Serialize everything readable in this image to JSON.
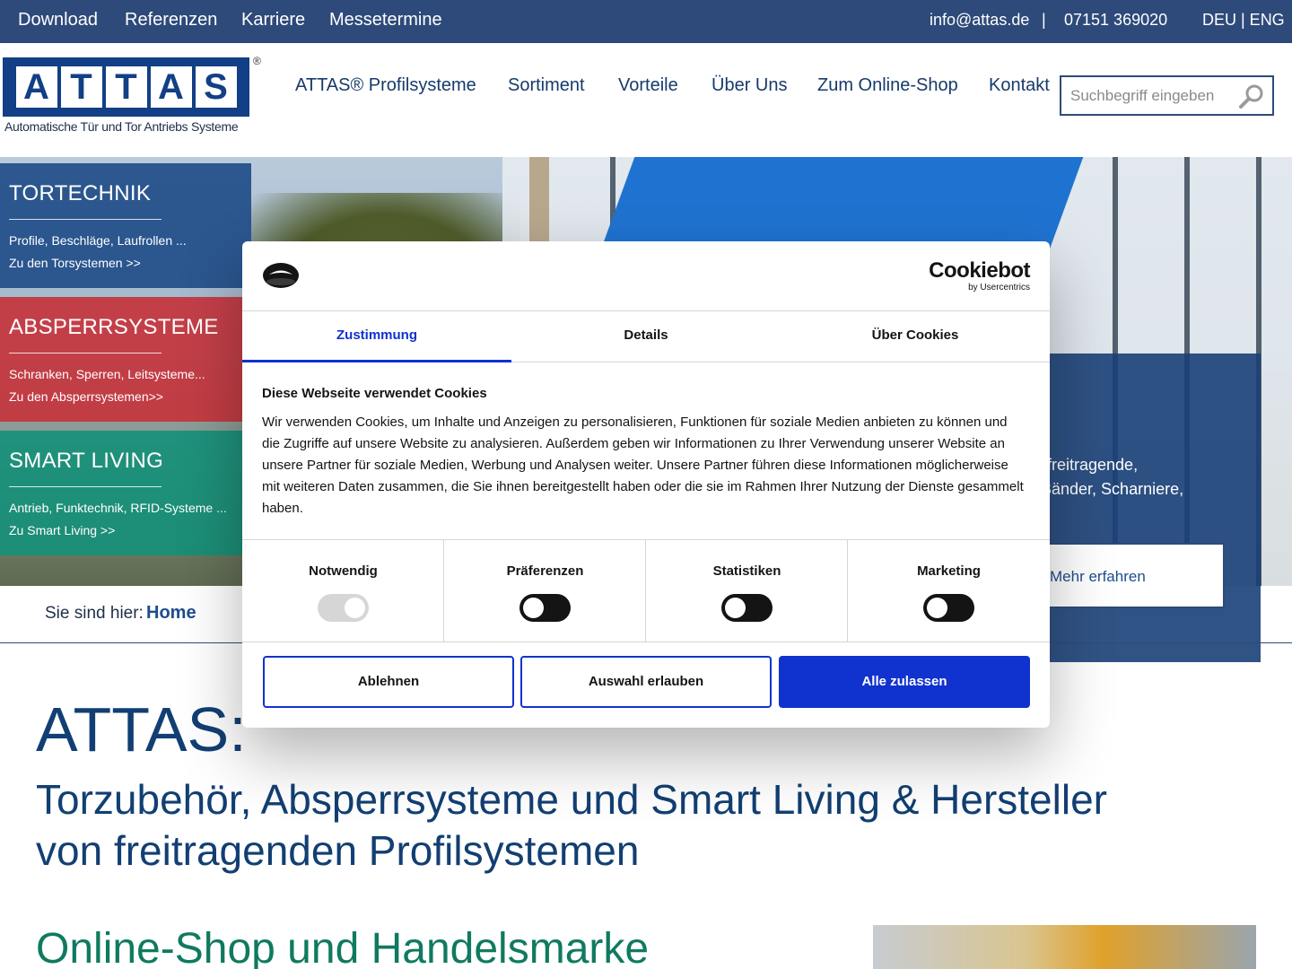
{
  "topbar": {
    "links": [
      "Download",
      "Referenzen",
      "Karriere",
      "Messetermine"
    ],
    "email": "info@attas.de",
    "separator": "|",
    "phone": "07151 369020",
    "lang": "DEU | ENG"
  },
  "header": {
    "logo_text": "ATTAS",
    "logo_letters": [
      "A",
      "T",
      "T",
      "A",
      "S"
    ],
    "logo_reg": "®",
    "logo_subtitle": "Automatische Tür und Tor Antriebs Systeme",
    "nav": [
      "ATTAS® Profilsysteme",
      "Sortiment",
      "Vorteile",
      "Über Uns",
      "Zum Online-Shop",
      "Kontakt"
    ],
    "search_placeholder": "Suchbegriff eingeben"
  },
  "sidebar": {
    "cards": [
      {
        "title": "TORTECHNIK",
        "desc": "Profile, Beschläge, Laufrollen ...",
        "link": "Zu den Torsystemen >>",
        "color": "#1d4a86"
      },
      {
        "title": "ABSPERRSYSTEME",
        "desc": "Schranken, Sperren, Leitsysteme...",
        "link": "Zu den Absperrsystemen>>",
        "color": "#c7323a"
      },
      {
        "title": "SMART LIVING",
        "desc": "Antrieb, Funktechnik, RFID-Systeme ...",
        "link": "Zu Smart Living >>",
        "color": "#14907a"
      }
    ]
  },
  "hero": {
    "text_line1": "freitragende,",
    "text_line2": "Bänder, Scharniere,",
    "button": "Mehr erfahren"
  },
  "breadcrumb": {
    "label": "Sie sind hier:",
    "home": "Home"
  },
  "content": {
    "heading": "ATTAS:",
    "subheading_line1": "Torzubehör, Absperrsysteme und Smart Living & Hersteller",
    "subheading_line2": "von freitragenden Profilsystemen",
    "section_title": "Online-Shop und Handelsmarke"
  },
  "cookie": {
    "brand": "Cookiebot",
    "brand_sub": "by Usercentrics",
    "tabs": [
      "Zustimmung",
      "Details",
      "Über Cookies"
    ],
    "title": "Diese Webseite verwendet Cookies",
    "text": "Wir verwenden Cookies, um Inhalte und Anzeigen zu personalisieren, Funktionen für soziale Medien anbieten zu können und die Zugriffe auf unsere Website zu analysieren. Außerdem geben wir Informationen zu Ihrer Verwendung unserer Website an unsere Partner für soziale Medien, Werbung und Analysen weiter. Unsere Partner führen diese Informationen möglicherweise mit weiteren Daten zusammen, die Sie ihnen bereitgestellt haben oder die sie im Rahmen Ihrer Nutzung der Dienste gesammelt haben.",
    "toggles": [
      {
        "label": "Notwendig",
        "state": "on-disabled"
      },
      {
        "label": "Präferenzen",
        "state": "off"
      },
      {
        "label": "Statistiken",
        "state": "off"
      },
      {
        "label": "Marketing",
        "state": "off"
      }
    ],
    "buttons": {
      "reject": "Ablehnen",
      "allow_selection": "Auswahl erlauben",
      "allow_all": "Alle zulassen"
    },
    "accent_color": "#1032cf"
  }
}
